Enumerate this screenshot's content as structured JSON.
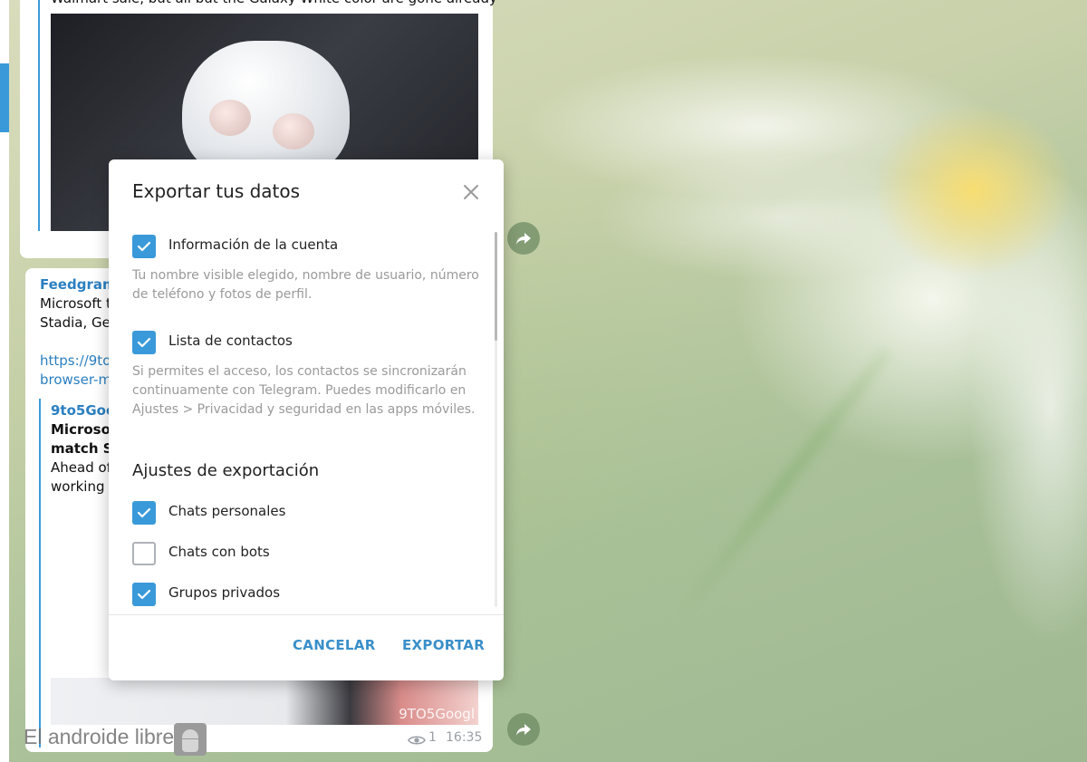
{
  "chat": {
    "top_message_text": "Walmart sale, but all but the Galaxy White color are gone already.",
    "main_message": {
      "sender": "Feedgram",
      "line1": "Microsoft t",
      "line2": "Stadia, Gel",
      "link_line1": "https://9to",
      "link_line2": "browser-m",
      "preview": {
        "site": "9to5Goo",
        "title_line1": "Microsof",
        "title_line2": "match St",
        "desc_line1": "Ahead of",
        "desc_line2": "working i"
      },
      "photo_watermark": "9TO5Googl",
      "views": "1",
      "time": "16:35"
    },
    "site_watermark": "El androide libre"
  },
  "dialog": {
    "title": "Exportar tus datos",
    "options": [
      {
        "label": "Información de la cuenta",
        "checked": true,
        "description": "Tu nombre visible elegido, nombre de usuario, número de teléfono y fotos de perfil."
      },
      {
        "label": "Lista de contactos",
        "checked": true,
        "description": "Si permites el acceso, los contactos se sincronizarán continuamente con Telegram. Puedes modificarlo en Ajustes > Privacidad y seguridad en las apps móviles."
      }
    ],
    "section_title": "Ajustes de exportación",
    "settings": [
      {
        "label": "Chats personales",
        "checked": true
      },
      {
        "label": "Chats con bots",
        "checked": false
      },
      {
        "label": "Grupos privados",
        "checked": true
      }
    ],
    "cancel_label": "CANCELAR",
    "export_label": "EXPORTAR"
  },
  "colors": {
    "accent": "#3a9ad9",
    "button_text": "#3a8fc9"
  }
}
